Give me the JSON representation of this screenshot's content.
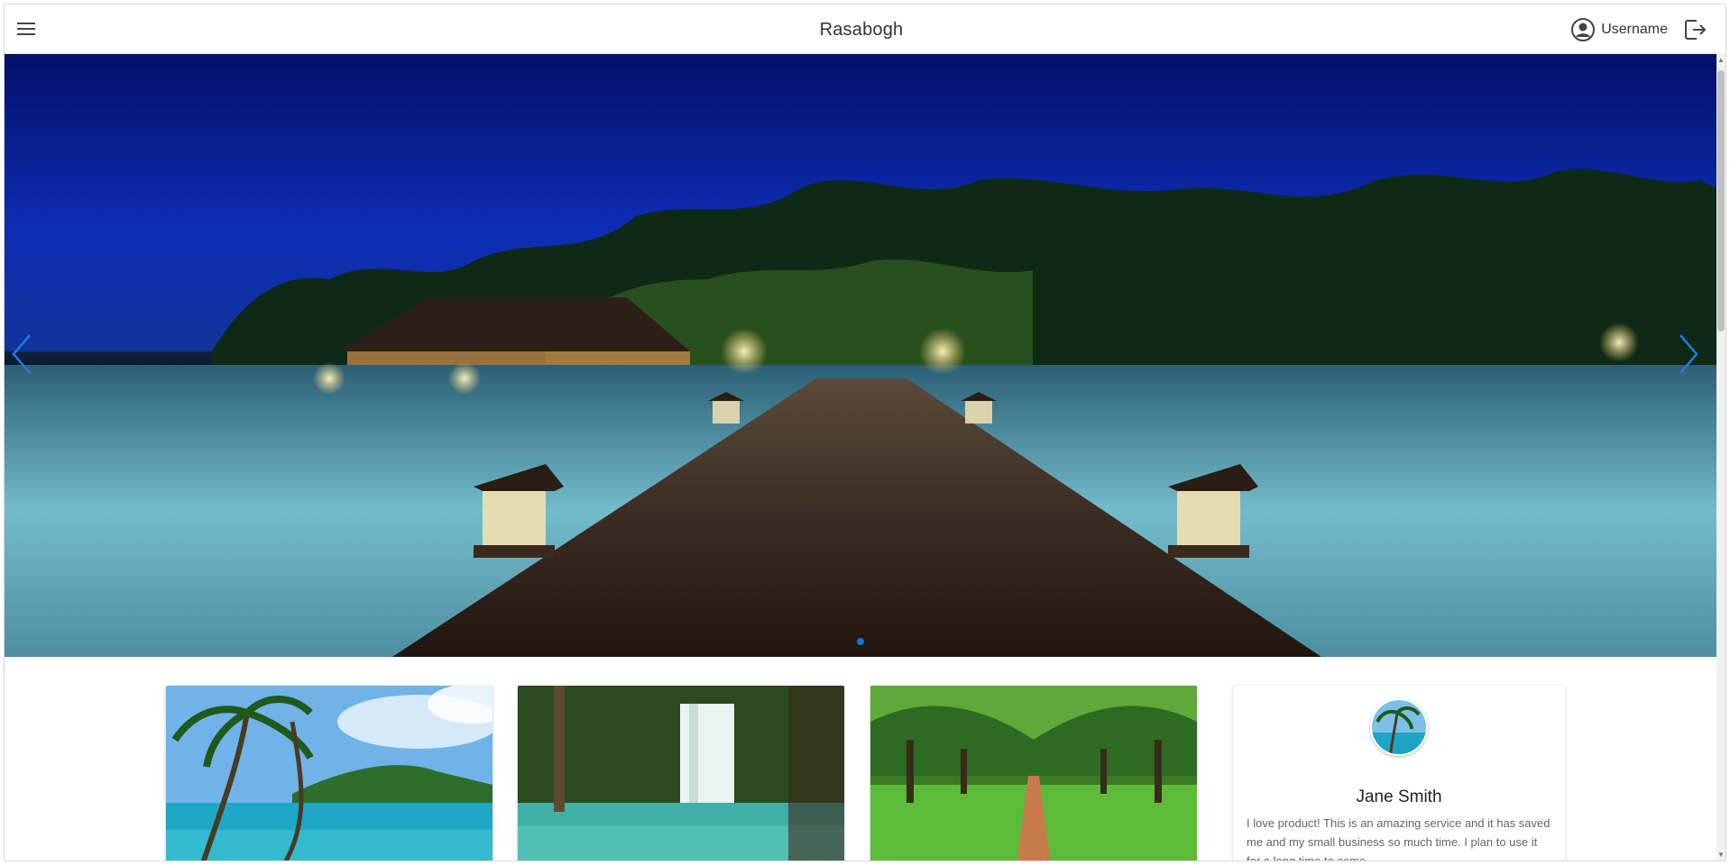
{
  "header": {
    "brand": "Rasabogh",
    "username": "Username",
    "icons": {
      "menu": "hamburger-menu-icon",
      "user": "account-circle-icon",
      "logout": "logout-icon"
    }
  },
  "carousel": {
    "slide_count": 1,
    "active_index": 0,
    "accent_color": "#1976d2",
    "icons": {
      "prev": "chevron-left-icon",
      "next": "chevron-right-icon"
    }
  },
  "testimonial": {
    "name": "Jane Smith",
    "text": "I love product! This is an amazing service and it has saved me and my small business so much time. I plan to use it for a long time to come."
  }
}
